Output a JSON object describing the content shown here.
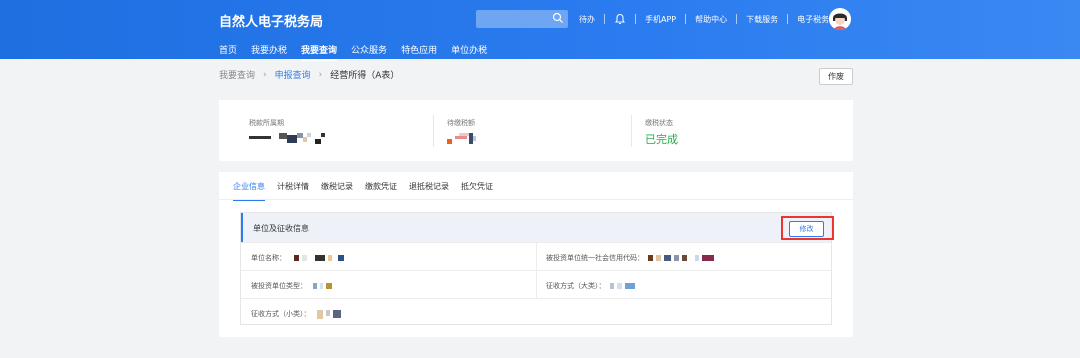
{
  "header": {
    "brand": "自然人电子税务局",
    "search_placeholder": "",
    "links": [
      "待办",
      "手机APP",
      "帮助中心",
      "下载服务",
      "电子税务局"
    ]
  },
  "nav": {
    "items": [
      {
        "label": "首页",
        "active": false
      },
      {
        "label": "我要办税",
        "active": false
      },
      {
        "label": "我要查询",
        "active": true
      },
      {
        "label": "公众服务",
        "active": false
      },
      {
        "label": "特色应用",
        "active": false
      },
      {
        "label": "单位办税",
        "active": false
      }
    ]
  },
  "breadcrumb": {
    "root": "我要查询",
    "middle": "申报查询",
    "current": "经营所得（A表）",
    "sep": "›"
  },
  "toolbar": {
    "void_label": "作废"
  },
  "summary": {
    "period_label": "税款所属期",
    "pending_label": "待缴税额",
    "status_label": "缴税状态",
    "status_value": "已完成"
  },
  "tabs": [
    "企业信息",
    "计税详情",
    "缴税记录",
    "缴款凭证",
    "退抵税记录",
    "抵欠凭证"
  ],
  "section": {
    "title": "单位及征收信息",
    "edit_label": "修改",
    "fields": {
      "unit_name": "单位名称：",
      "credit_code": "被投资单位统一社会信用代码：",
      "unit_type": "被投资单位类型：",
      "collect_major": "征收方式（大类）：",
      "collect_minor": "征收方式（小类）："
    }
  },
  "colors": {
    "brand": "#2b7cf0",
    "success": "#2aa94b",
    "highlight": "#ee3333"
  }
}
